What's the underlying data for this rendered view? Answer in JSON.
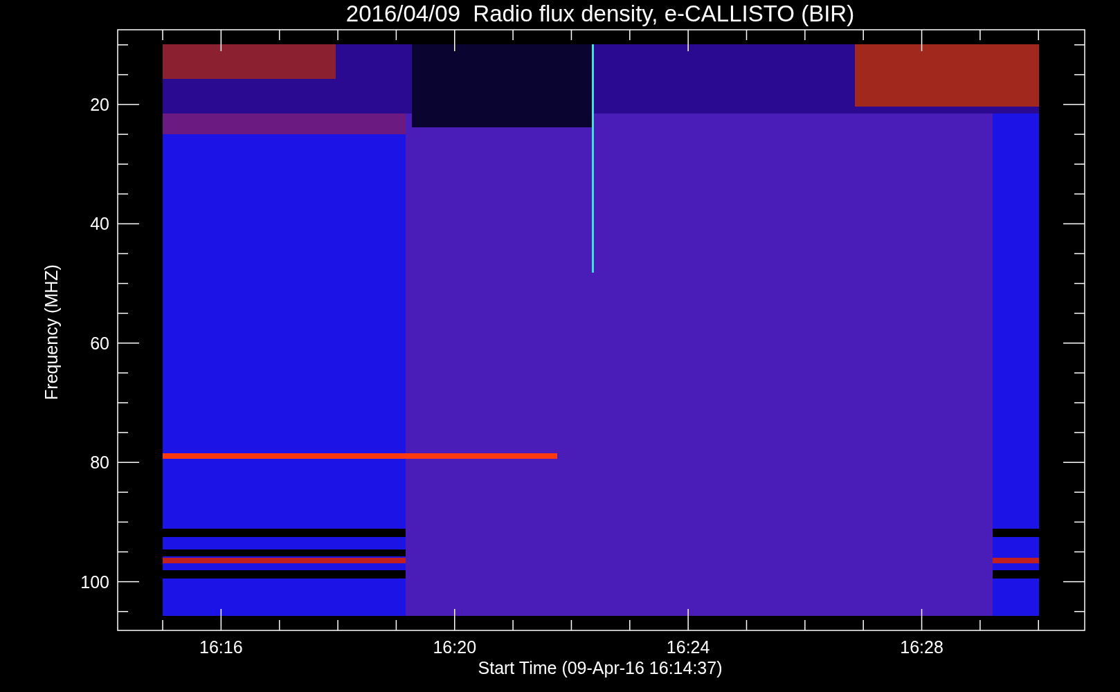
{
  "plot": {
    "title": "2016/04/09  Radio flux density, e-CALLISTO (BIR)",
    "ylabel": "Frequency (MHZ)",
    "xlabel": "Start Time (09-Apr-16 16:14:37)",
    "yticks": [
      "20",
      "40",
      "60",
      "80",
      "100"
    ],
    "xticks": [
      "16:16",
      "16:20",
      "16:24",
      "16:28"
    ]
  }
}
